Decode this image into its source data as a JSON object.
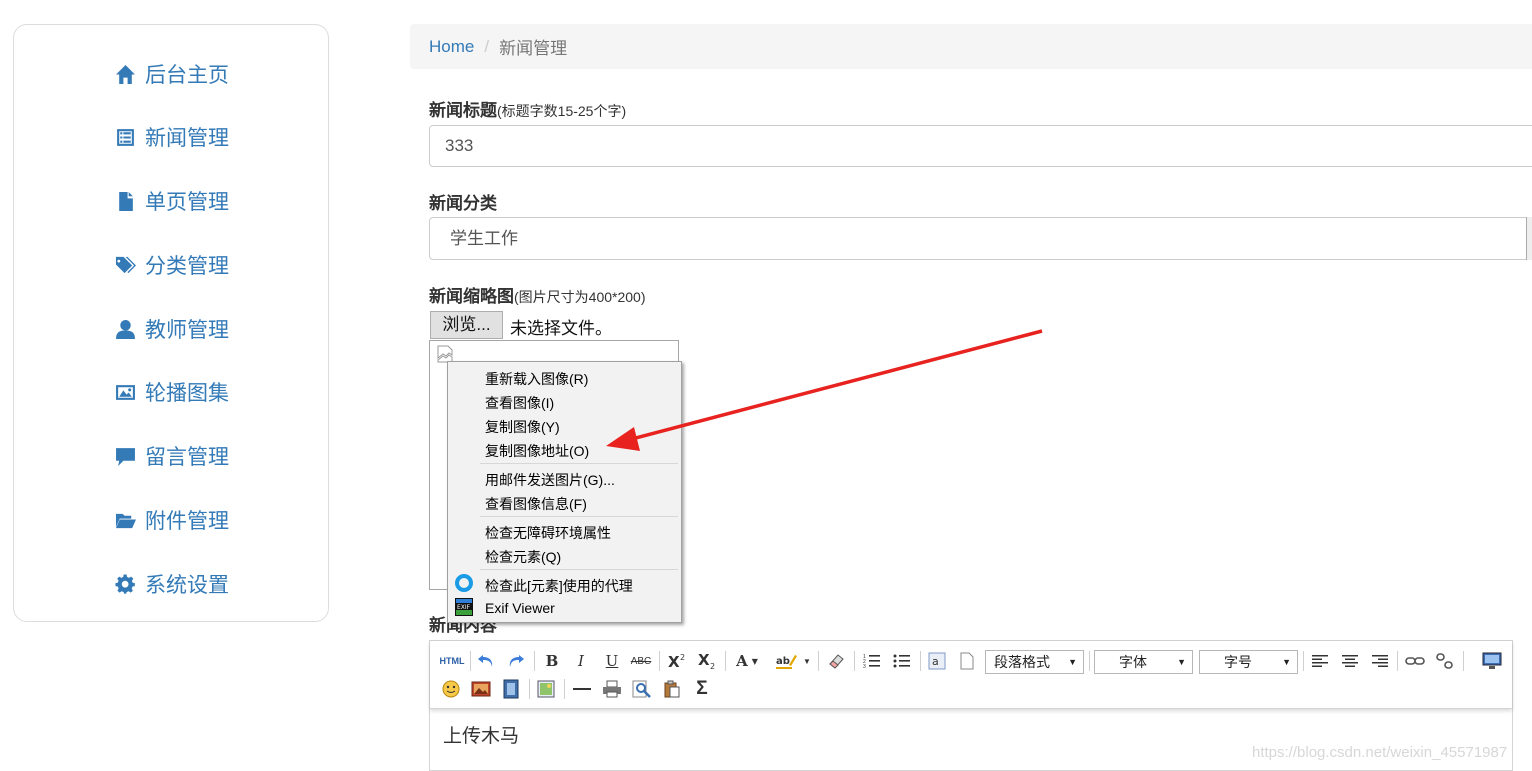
{
  "sidebar": {
    "items": [
      {
        "label": "后台主页",
        "icon": "home-icon"
      },
      {
        "label": "新闻管理",
        "icon": "list-icon"
      },
      {
        "label": "单页管理",
        "icon": "file-icon"
      },
      {
        "label": "分类管理",
        "icon": "tags-icon"
      },
      {
        "label": "教师管理",
        "icon": "user-icon"
      },
      {
        "label": "轮播图集",
        "icon": "picture-icon"
      },
      {
        "label": "留言管理",
        "icon": "comment-icon"
      },
      {
        "label": "附件管理",
        "icon": "folder-open-icon"
      },
      {
        "label": "系统设置",
        "icon": "gear-icon"
      }
    ]
  },
  "breadcrumb": {
    "home": "Home",
    "separator": "/",
    "current": "新闻管理"
  },
  "form": {
    "title_label": "新闻标题",
    "title_hint": "(标题字数15-25个字)",
    "title_value": "333",
    "category_label": "新闻分类",
    "category_value": "学生工作",
    "thumb_label": "新闻缩略图",
    "thumb_hint": "(图片尺寸为400*200)",
    "browse_button": "浏览...",
    "file_status": "未选择文件。",
    "content_label": "新闻内容"
  },
  "context_menu": {
    "items": [
      {
        "label": "重新载入图像(R)"
      },
      {
        "label": "查看图像(I)"
      },
      {
        "label": "复制图像(Y)"
      },
      {
        "label": "复制图像地址(O)"
      },
      {
        "label": "用邮件发送图片(G)..."
      },
      {
        "label": "查看图像信息(F)"
      },
      {
        "label": "检查无障碍环境属性"
      },
      {
        "label": "检查元素(Q)"
      },
      {
        "label": "检查此[元素]使用的代理",
        "icon": "proxy-ring-icon"
      },
      {
        "label": "Exif Viewer",
        "icon": "exif-icon"
      }
    ]
  },
  "editor": {
    "toolbar": {
      "html_label": "HTML",
      "bold": "B",
      "italic": "I",
      "underline": "U",
      "strike": "ABC",
      "font_color": "A",
      "sum": "Σ",
      "paragraph_combo": "段落格式",
      "font_combo": "字体",
      "size_combo": "字号"
    },
    "content": "上传木马"
  },
  "watermark": "https://blog.csdn.net/weixin_45571987",
  "colors": {
    "link": "#337ab7",
    "arrow": "#e8231f"
  }
}
